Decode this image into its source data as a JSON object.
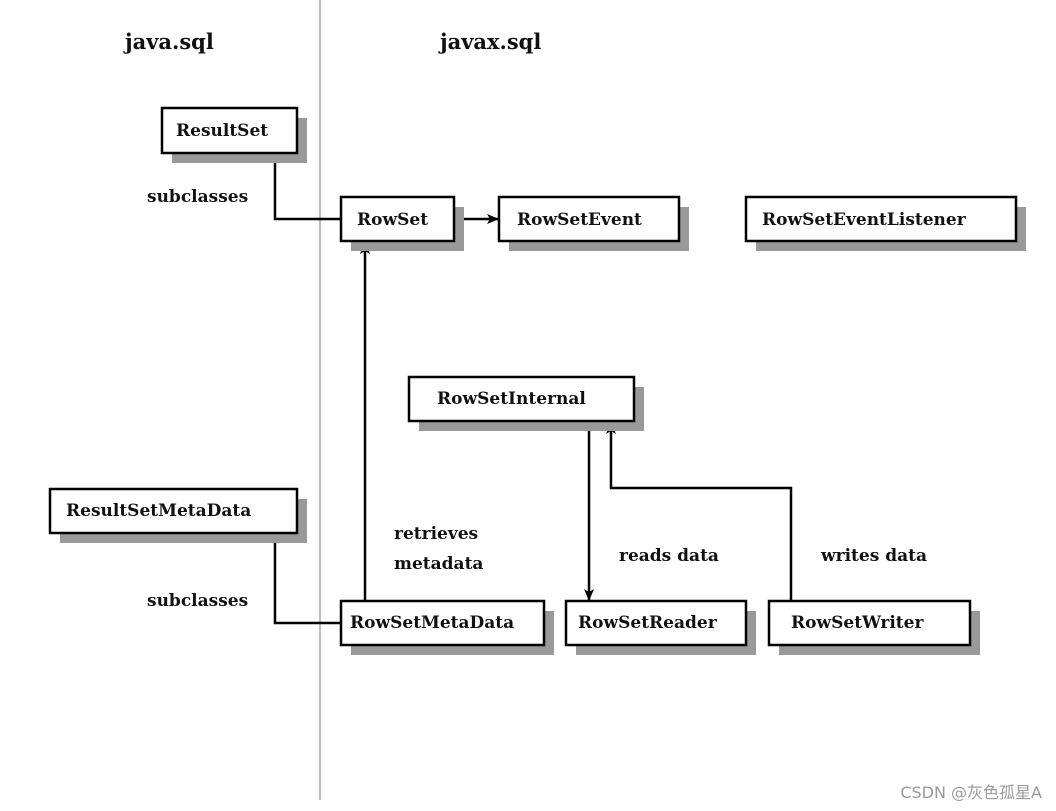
{
  "packages": {
    "left": "java.sql",
    "right": "javax.sql"
  },
  "boxes": {
    "result_set": "ResultSet",
    "row_set": "RowSet",
    "row_set_event": "RowSetEvent",
    "row_set_event_listener": "RowSetEventListener",
    "row_set_internal": "RowSetInternal",
    "result_set_meta_data": "ResultSetMetaData",
    "row_set_meta_data": "RowSetMetaData",
    "row_set_reader": "RowSetReader",
    "row_set_writer": "RowSetWriter"
  },
  "labels": {
    "subclasses_top": "subclasses",
    "subclasses_bottom": "subclasses",
    "retrieves": "retrieves",
    "metadata": "metadata",
    "reads_data": "reads data",
    "writes_data": "writes data"
  },
  "watermark": "CSDN @灰色孤星A"
}
